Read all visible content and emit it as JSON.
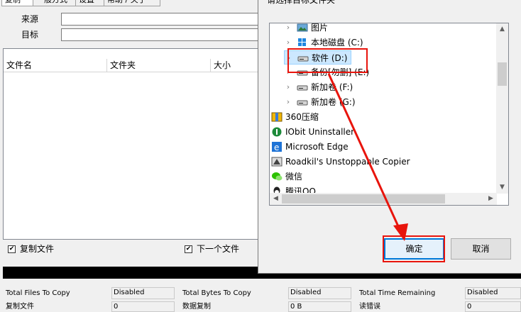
{
  "main": {
    "tabs": [
      "复制",
      "一般方式",
      "设置",
      "帮助 / 关于"
    ],
    "source_label": "来源",
    "target_label": "目标",
    "columns": [
      "文件名",
      "文件夹",
      "大小"
    ],
    "copy_files_label": "复制文件",
    "next_file_label": "下一个文件"
  },
  "status": {
    "total_files_label": "Total Files To Copy",
    "total_files_value": "Disabled",
    "total_bytes_label": "Total Bytes To Copy",
    "total_bytes_value": "Disabled",
    "time_remaining_label": "Total Time Remaining",
    "time_remaining_value": "Disabled",
    "copied_files_label": "复制文件",
    "copied_files_value": "0",
    "copied_data_label": "数据复制",
    "copied_data_value": "0 B",
    "read_errors_label": "读错误",
    "read_errors_value": "0"
  },
  "dialog": {
    "description": "请选择目标文件夹",
    "tree_items": [
      {
        "label": "图片",
        "icon": "pictures-icon",
        "has_chevron": true
      },
      {
        "label": "本地磁盘 (C:)",
        "icon": "windows-drive-icon",
        "has_chevron": true
      },
      {
        "label": "软件 (D:)",
        "icon": "drive-icon",
        "has_chevron": true,
        "selected": true
      },
      {
        "label": "备份[勿删] (E:)",
        "icon": "drive-icon",
        "has_chevron": true
      },
      {
        "label": "新加卷 (F:)",
        "icon": "drive-icon",
        "has_chevron": true
      },
      {
        "label": "新加卷 (G:)",
        "icon": "drive-icon",
        "has_chevron": true
      },
      {
        "label": "360压缩",
        "icon": "360-zip-icon",
        "has_chevron": false
      },
      {
        "label": "IObit Uninstaller",
        "icon": "iobit-icon",
        "has_chevron": false
      },
      {
        "label": "Microsoft Edge",
        "icon": "edge-icon",
        "has_chevron": false
      },
      {
        "label": "Roadkil's Unstoppable Copier",
        "icon": "copier-icon",
        "has_chevron": false
      },
      {
        "label": "微信",
        "icon": "wechat-icon",
        "has_chevron": false
      },
      {
        "label": "腾讯QQ",
        "icon": "qq-icon",
        "has_chevron": false
      }
    ],
    "ok_label": "确定",
    "cancel_label": "取消"
  },
  "colors": {
    "annotation_red": "#e8140c",
    "selection_fill": "#cce8ff",
    "primary_button_border": "#0078d7"
  }
}
